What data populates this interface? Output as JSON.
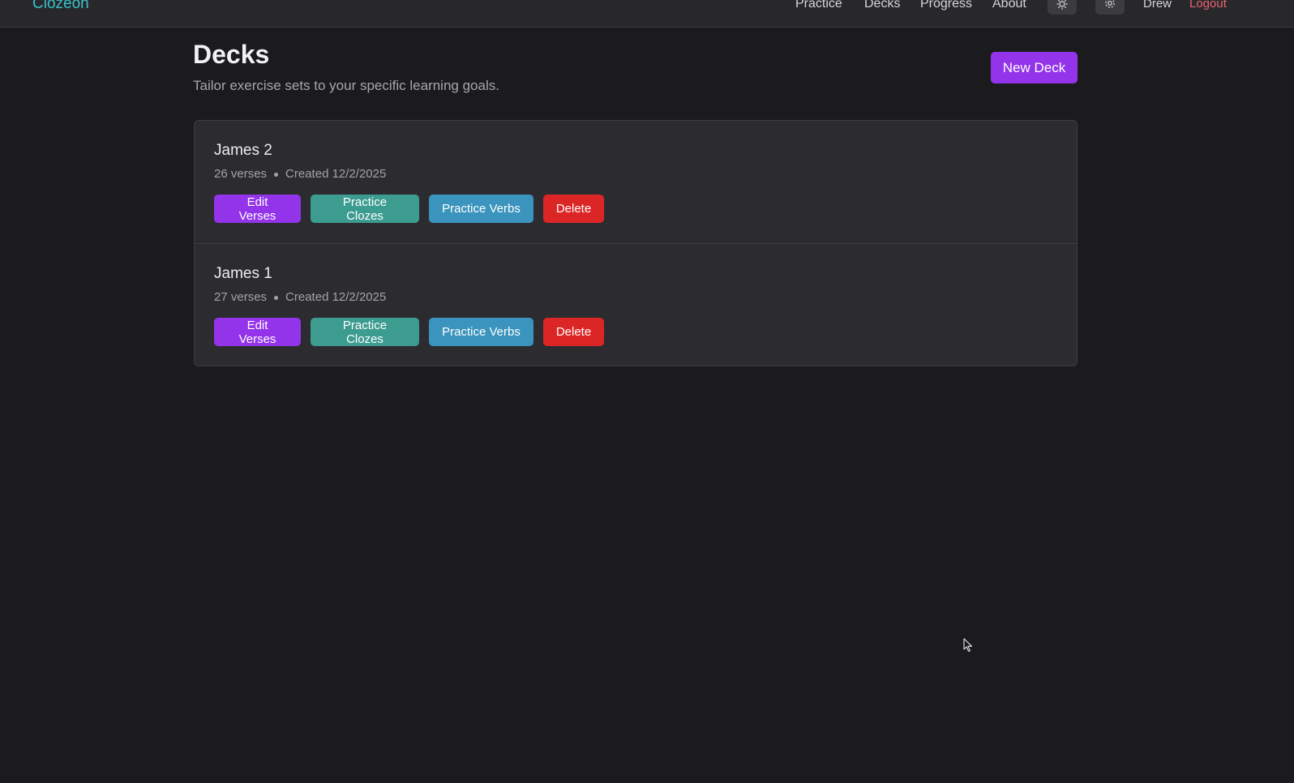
{
  "app": {
    "brand": "Clozeon"
  },
  "nav": {
    "links": [
      "Practice",
      "Decks",
      "Progress",
      "About"
    ],
    "user": "Drew",
    "logout": "Logout"
  },
  "icons": {
    "theme": "sun-icon",
    "settings": "gear-icon"
  },
  "colors": {
    "brand": "#36c3cc",
    "primary": "#9333ea",
    "cloze": "#3d9c90",
    "verbs": "#3a94bd",
    "danger": "#dc2626",
    "logout": "#e8636f"
  },
  "page": {
    "title": "Decks",
    "subtitle": "Tailor exercise sets to your specific learning goals.",
    "new_deck_label": "New Deck"
  },
  "decks": [
    {
      "name": "James 2",
      "verses": "26 verses",
      "created": "Created 12/2/2025"
    },
    {
      "name": "James 1",
      "verses": "27 verses",
      "created": "Created 12/2/2025"
    }
  ],
  "deck_actions": {
    "edit": "Edit Verses",
    "cloze": "Practice Clozes",
    "verbs": "Practice Verbs",
    "delete": "Delete"
  }
}
